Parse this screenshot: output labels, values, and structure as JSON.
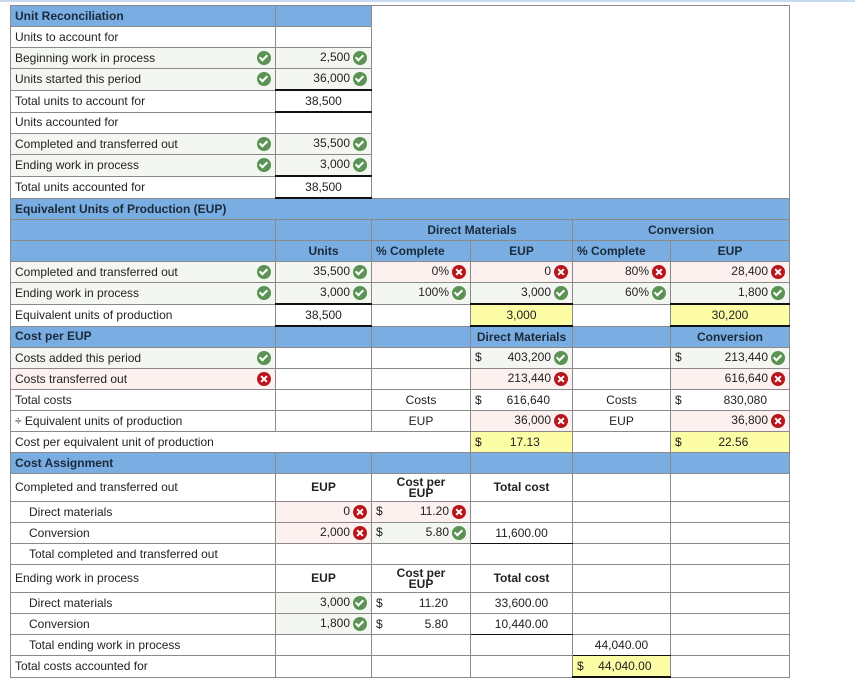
{
  "colors": {
    "header_blue": "#7aaee3",
    "highlight_yellow": "#fdfda6",
    "correct_green": "#5a9354",
    "wrong_red": "#b7161c"
  },
  "unit_reconciliation": {
    "title": "Unit Reconciliation",
    "to_account_label": "Units to account for",
    "rows_in": [
      {
        "label": "Beginning work in process",
        "label_status": "correct",
        "value": "2,500",
        "value_status": "correct"
      },
      {
        "label": "Units started this period",
        "label_status": "correct",
        "value": "36,000",
        "value_status": "correct"
      }
    ],
    "total_in": {
      "label": "Total units to account for",
      "value": "38,500"
    },
    "accounted_label": "Units accounted for",
    "rows_out": [
      {
        "label": "Completed and transferred out",
        "label_status": "correct",
        "value": "35,500",
        "value_status": "correct"
      },
      {
        "label": "Ending work in process",
        "label_status": "correct",
        "value": "3,000",
        "value_status": "correct"
      }
    ],
    "total_out": {
      "label": "Total units accounted for",
      "value": "38,500"
    }
  },
  "eup": {
    "title": "Equivalent Units of Production (EUP)",
    "group_dm": "Direct Materials",
    "group_conv": "Conversion",
    "col_units": "Units",
    "col_pct": "% Complete",
    "col_eup": "EUP",
    "rows": [
      {
        "label": "Completed and transferred out",
        "label_status": "correct",
        "units": "35,500",
        "units_status": "correct",
        "dm_pct": "0%",
        "dm_pct_status": "wrong",
        "dm_eup": "0",
        "dm_eup_status": "wrong",
        "conv_pct": "80%",
        "conv_pct_status": "wrong",
        "conv_eup": "28,400",
        "conv_eup_status": "wrong"
      },
      {
        "label": "Ending work in process",
        "label_status": "correct",
        "units": "3,000",
        "units_status": "correct",
        "dm_pct": "100%",
        "dm_pct_status": "correct",
        "dm_eup": "3,000",
        "dm_eup_status": "correct",
        "conv_pct": "60%",
        "conv_pct_status": "correct",
        "conv_eup": "1,800",
        "conv_eup_status": "correct"
      }
    ],
    "total": {
      "label": "Equivalent units of production",
      "units": "38,500",
      "dm_eup": "3,000",
      "conv_eup": "30,200"
    }
  },
  "cost_per_eup": {
    "title": "Cost per EUP",
    "dm_header": "Direct Materials",
    "conv_header": "Conversion",
    "currency": "$",
    "added": {
      "label": "Costs added this period",
      "label_status": "correct",
      "dm": "403,200",
      "dm_status": "correct",
      "conv": "213,440",
      "conv_status": "correct"
    },
    "transferred": {
      "label": "Costs transferred out",
      "label_status": "wrong",
      "dm": "213,440",
      "dm_status": "wrong",
      "conv": "616,640",
      "conv_status": "wrong"
    },
    "total": {
      "label": "Total costs",
      "side_label": "Costs",
      "dm": "616,640",
      "conv": "830,080"
    },
    "divide": {
      "label": "÷ Equivalent units of production",
      "side_label": "EUP",
      "dm": "36,000",
      "dm_status": "wrong",
      "conv": "36,800",
      "conv_status": "wrong"
    },
    "per_unit": {
      "label": "Cost per equivalent unit of production",
      "dm": "17.13",
      "conv": "22.56"
    }
  },
  "cost_assignment": {
    "title": "Cost Assignment",
    "col_eup": "EUP",
    "col_cost_per_line1": "Cost per",
    "col_cost_per_line2": "EUP",
    "col_total": "Total cost",
    "currency": "$",
    "completed": {
      "label": "Completed and transferred out",
      "rows": [
        {
          "label": "Direct materials",
          "eup": "0",
          "eup_status": "wrong",
          "cost": "11.20",
          "cost_status": "wrong",
          "total": ""
        },
        {
          "label": "Conversion",
          "eup": "2,000",
          "eup_status": "wrong",
          "cost": "5.80",
          "cost_status": "correct",
          "total": "11,600.00"
        }
      ],
      "total_label": "Total completed and transferred out",
      "total_value": ""
    },
    "ending": {
      "label": "Ending work in process",
      "rows": [
        {
          "label": "Direct materials",
          "eup": "3,000",
          "eup_status": "correct",
          "cost": "11.20",
          "total": "33,600.00"
        },
        {
          "label": "Conversion",
          "eup": "1,800",
          "eup_status": "correct",
          "cost": "5.80",
          "total": "10,440.00"
        }
      ],
      "total_label": "Total ending work in process",
      "total_value": "44,040.00"
    },
    "grand_total": {
      "label": "Total costs accounted for",
      "value": "44,040.00"
    }
  }
}
